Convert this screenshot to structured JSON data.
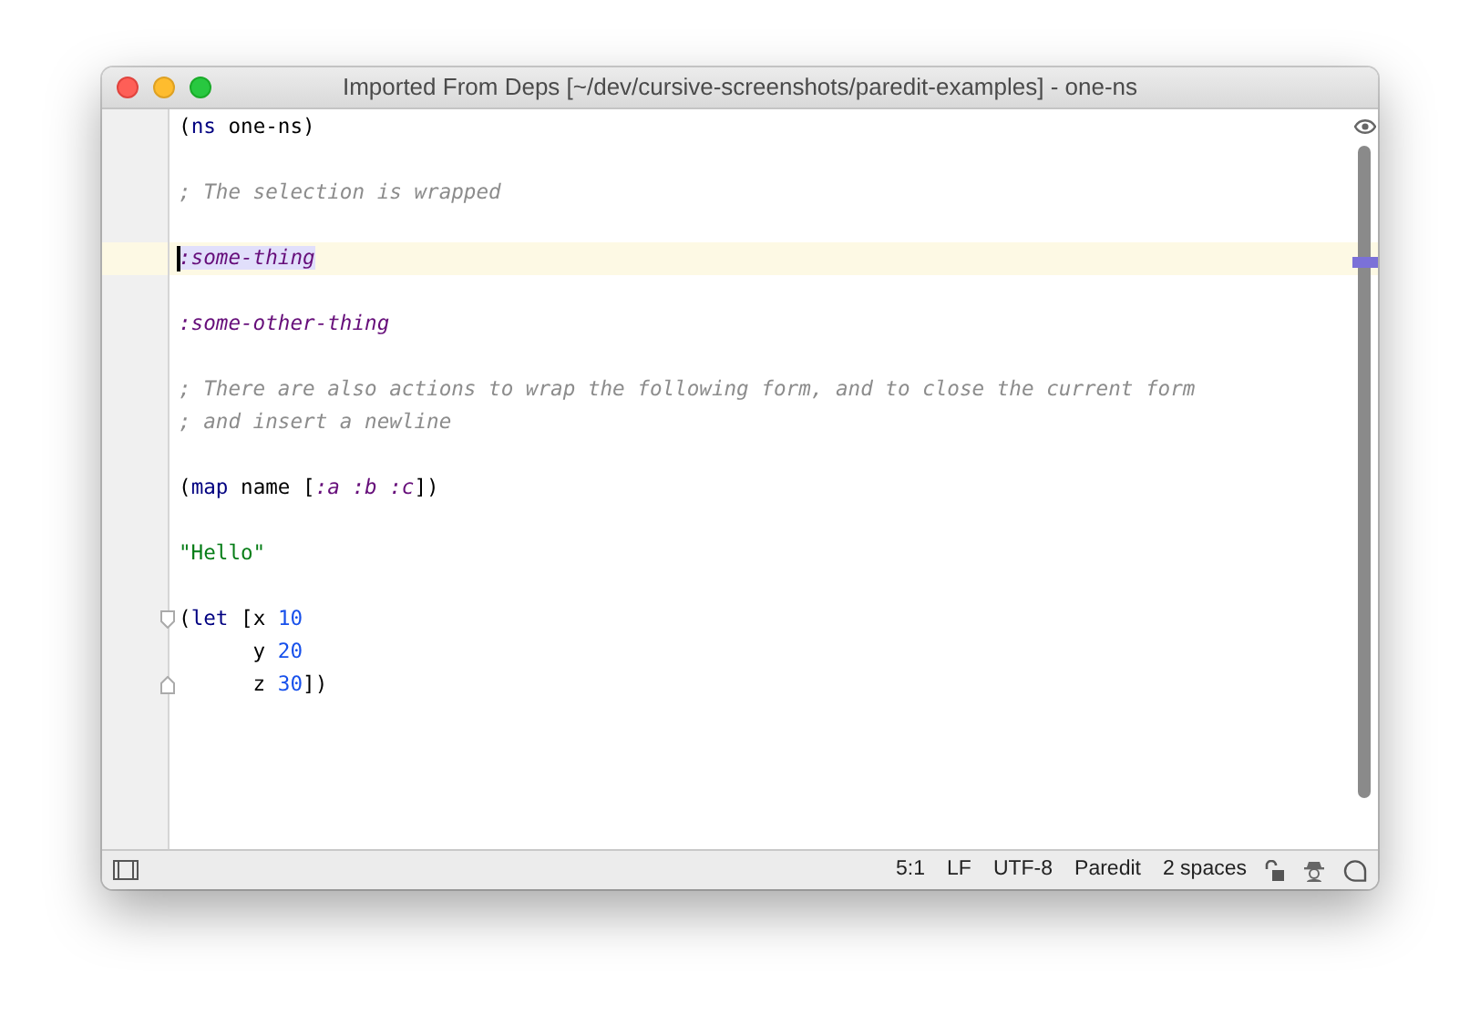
{
  "window": {
    "title": "Imported From Deps [~/dev/cursive-screenshots/paredit-examples] - one-ns"
  },
  "editor": {
    "lines": [
      {
        "kind": "code",
        "tokens": [
          {
            "kind": "plain",
            "text": "("
          },
          {
            "kind": "keyword",
            "text": "ns"
          },
          {
            "kind": "plain",
            "text": " one-ns)"
          }
        ]
      },
      {
        "kind": "blank"
      },
      {
        "kind": "code",
        "tokens": [
          {
            "kind": "comment",
            "text": "; The selection is wrapped"
          }
        ]
      },
      {
        "kind": "blank"
      },
      {
        "kind": "code",
        "current": true,
        "caret": true,
        "tokens": [
          {
            "kind": "symbol",
            "text": ":some-thing",
            "selected": true
          }
        ]
      },
      {
        "kind": "blank"
      },
      {
        "kind": "code",
        "tokens": [
          {
            "kind": "symbol",
            "text": ":some-other-thing"
          }
        ]
      },
      {
        "kind": "blank"
      },
      {
        "kind": "code",
        "tokens": [
          {
            "kind": "comment",
            "text": "; There are also actions to wrap the following form, and to close the current form"
          }
        ]
      },
      {
        "kind": "code",
        "tokens": [
          {
            "kind": "comment",
            "text": "; and insert a newline"
          }
        ]
      },
      {
        "kind": "blank"
      },
      {
        "kind": "code",
        "tokens": [
          {
            "kind": "plain",
            "text": "("
          },
          {
            "kind": "keyword",
            "text": "map"
          },
          {
            "kind": "plain",
            "text": " name ["
          },
          {
            "kind": "symbol",
            "text": ":a :b :c"
          },
          {
            "kind": "plain",
            "text": "])"
          }
        ]
      },
      {
        "kind": "blank"
      },
      {
        "kind": "code",
        "tokens": [
          {
            "kind": "string",
            "text": "\"Hello\""
          }
        ]
      },
      {
        "kind": "blank"
      },
      {
        "kind": "code",
        "fold_start": true,
        "tokens": [
          {
            "kind": "plain",
            "text": "("
          },
          {
            "kind": "keyword",
            "text": "let"
          },
          {
            "kind": "plain",
            "text": " [x "
          },
          {
            "kind": "number",
            "text": "10"
          }
        ]
      },
      {
        "kind": "code",
        "tokens": [
          {
            "kind": "plain",
            "text": "      y "
          },
          {
            "kind": "number",
            "text": "20"
          }
        ]
      },
      {
        "kind": "code",
        "fold_end": true,
        "tokens": [
          {
            "kind": "plain",
            "text": "      z "
          },
          {
            "kind": "number",
            "text": "30"
          },
          {
            "kind": "plain",
            "text": "])"
          }
        ]
      }
    ]
  },
  "status_bar": {
    "items": [
      "5:1",
      "LF",
      "UTF-8",
      "Paredit",
      "2 spaces"
    ]
  }
}
